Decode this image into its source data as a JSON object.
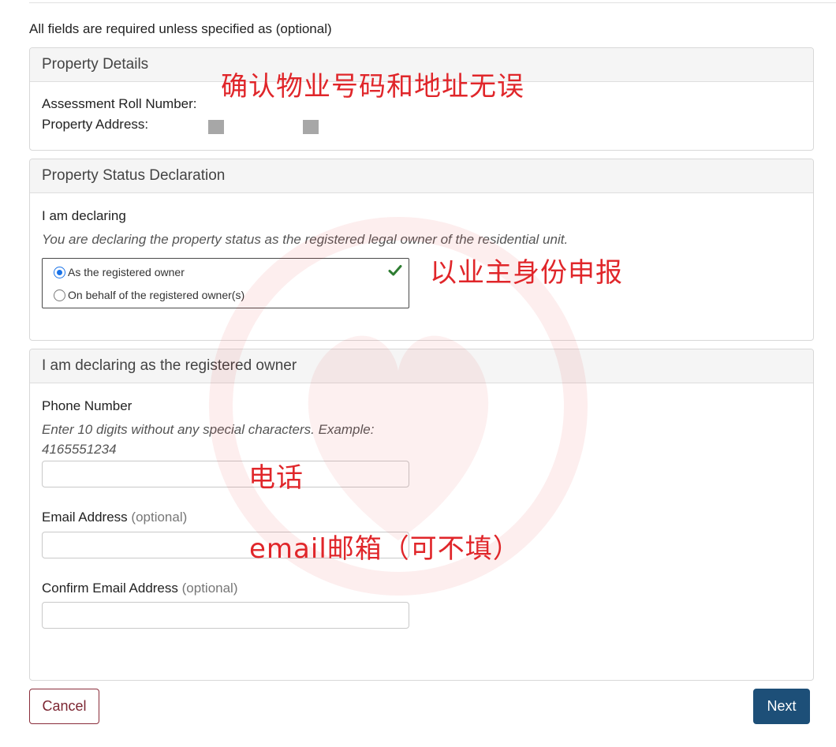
{
  "note": "All fields are required unless specified as (optional)",
  "property_details": {
    "header": "Property Details",
    "roll_label": "Assessment Roll Number:",
    "address_label": "Property Address:"
  },
  "status": {
    "header": "Property Status Declaration",
    "declaring_label": "I am declaring",
    "hint": "You are declaring the property status as the registered legal owner of the residential unit.",
    "options": [
      {
        "label": "As the registered owner",
        "selected": true
      },
      {
        "label": "On behalf of the registered owner(s)",
        "selected": false
      }
    ]
  },
  "owner": {
    "header": "I am declaring as the registered owner",
    "phone_label": "Phone Number",
    "phone_hint_1": "Enter 10 digits without any special characters. Example:",
    "phone_hint_2": "4165551234",
    "phone_value": "",
    "email_label": "Email Address",
    "confirm_email_label": "Confirm Email Address",
    "optional_tag": "(optional)",
    "email_value": "",
    "confirm_email_value": ""
  },
  "actions": {
    "cancel": "Cancel",
    "next": "Next"
  },
  "annotations": {
    "property": "确认物业号码和地址无误",
    "owner": "以业主身份申报",
    "phone": "电话",
    "email": "email邮箱（可不填）"
  },
  "colors": {
    "accent": "#1d4f78",
    "cancel_border": "#8a2d3a",
    "annotation": "#e0262a",
    "check": "#2e7d32"
  },
  "icons": {
    "check": "check-icon",
    "watermark": "heart-logo-watermark"
  }
}
